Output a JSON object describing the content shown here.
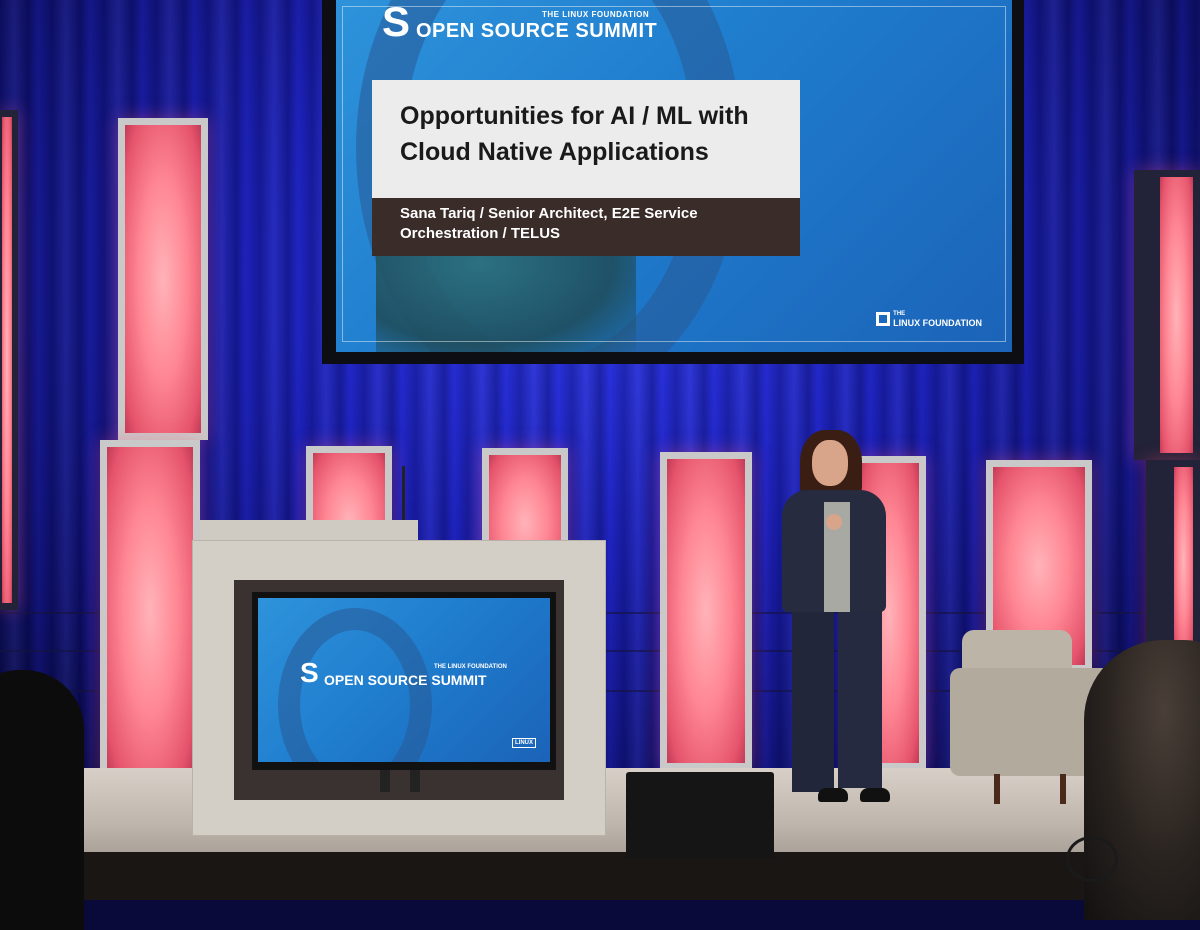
{
  "slide": {
    "event_small": "THE LINUX FOUNDATION",
    "event_name": "OPEN SOURCE SUMMIT",
    "title": "Opportunities for AI / ML with Cloud Native Applications",
    "speaker": "Sana Tariq / Senior Architect, E2E Service Orchestration / TELUS",
    "footer_logo_small": "THE",
    "footer_logo_name": "LINUX FOUNDATION"
  },
  "monitor": {
    "event_small": "THE LINUX FOUNDATION",
    "event_name": "OPEN SOURCE SUMMIT",
    "corner_logo": "LINUX"
  },
  "colors": {
    "curtain": "#1a1fb8",
    "slide_blue": "#1f7ccd",
    "column_pink": "#ff8794",
    "speaker_bar": "#3a2c28"
  }
}
